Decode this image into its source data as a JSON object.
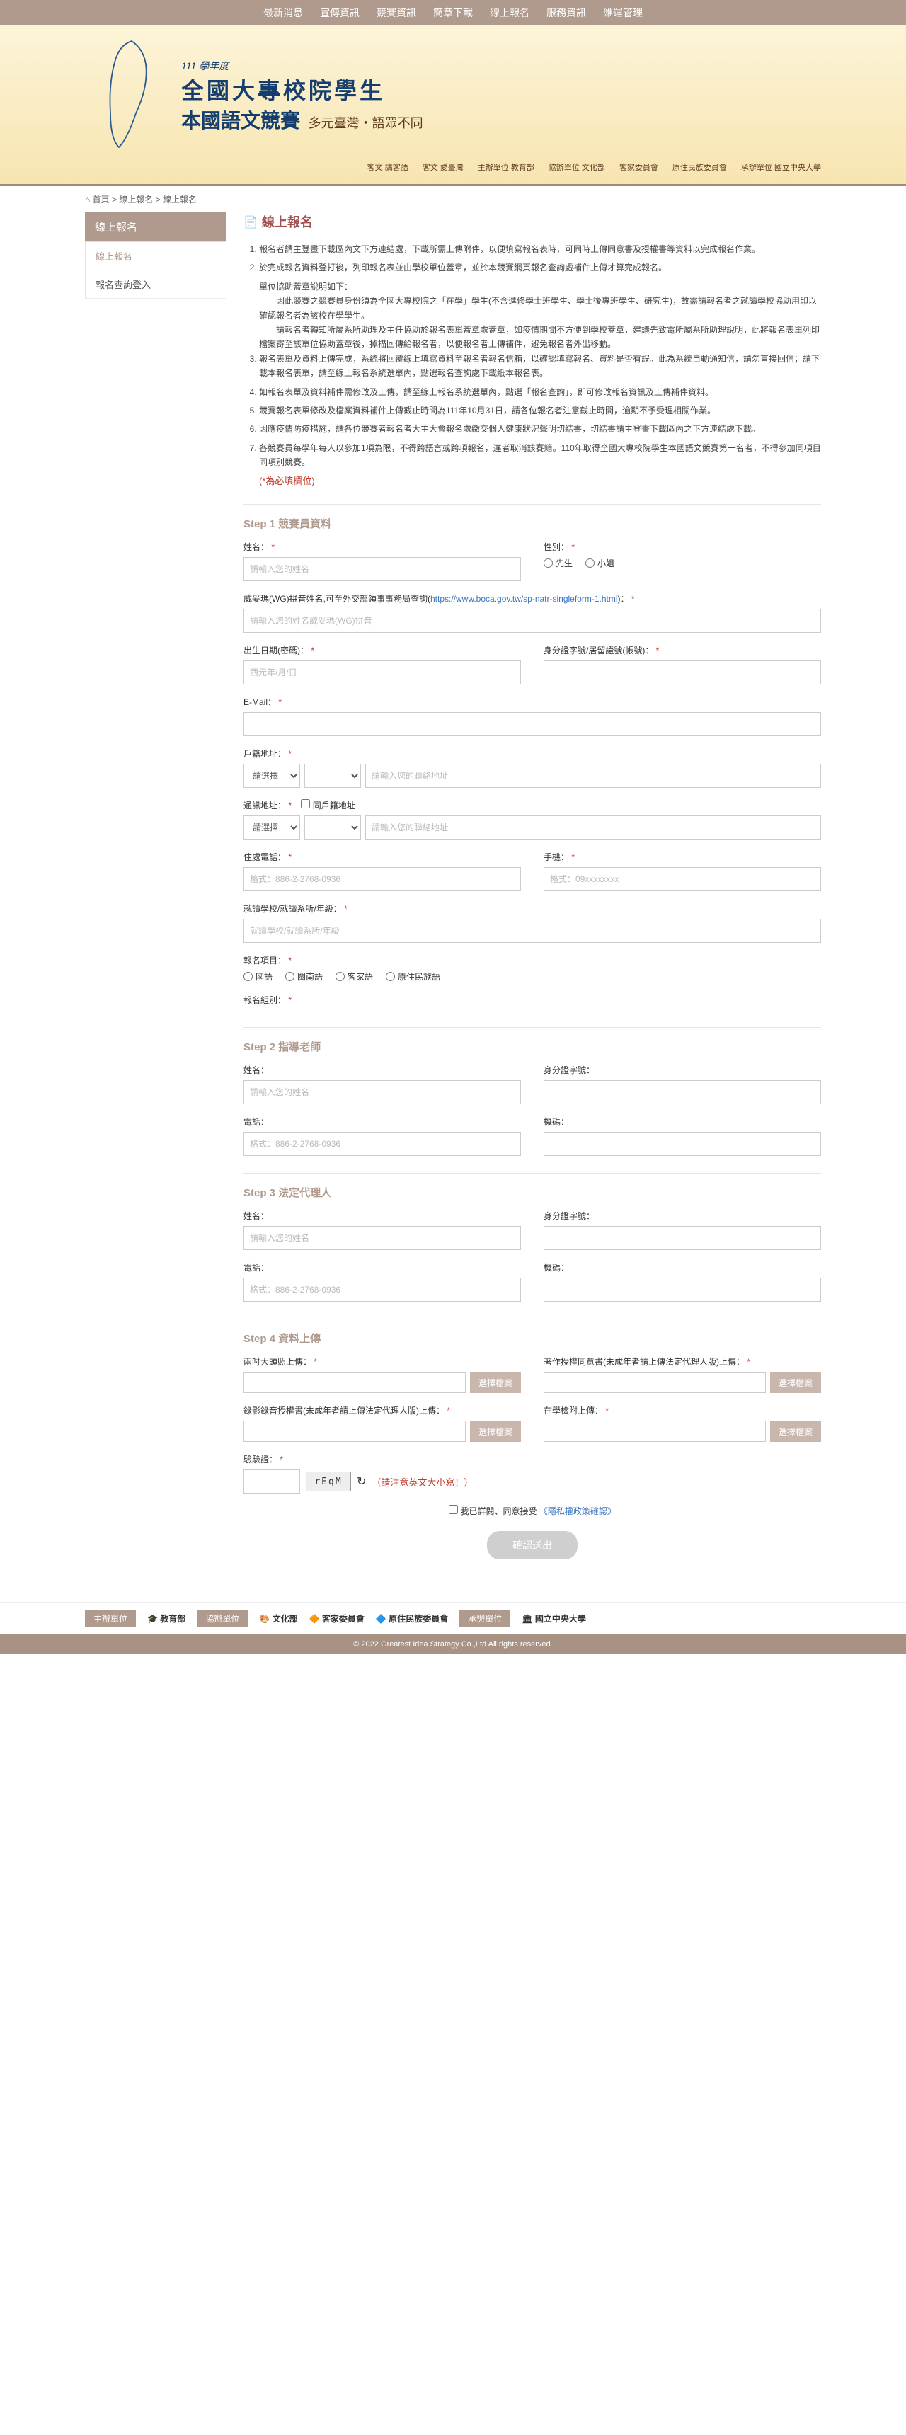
{
  "nav": [
    "最新消息",
    "宣傳資訊",
    "競賽資訊",
    "簡章下載",
    "線上報名",
    "服務資訊",
    "維運管理"
  ],
  "banner": {
    "year": "111 學年度",
    "line1": "全國大專校院學生",
    "line2": "本國語文競賽",
    "calli": "多元臺灣・語眾不同",
    "logos": [
      "客文 講客語",
      "客文 愛臺灣",
      "主辦單位 教育部",
      "協辦單位 文化部",
      "客家委員會",
      "原住民族委員會",
      "承辦單位 國立中央大學"
    ]
  },
  "crumbs": {
    "home": "首頁",
    "p1": "線上報名",
    "p2": "線上報名"
  },
  "sidebar": {
    "title": "線上報名",
    "items": [
      "線上報名",
      "報名查詢登入"
    ]
  },
  "page": {
    "title": "線上報名"
  },
  "instructions": [
    "報名者請主登畫下載區內文下方連結處，下載所需上傳附件，以便填寫報名表時，可同時上傳同意書及授權書等資料以完成報名作業。",
    "於完成報名資料登打後，列印報名表並由學校單位蓋章，並於本競賽網頁報名查詢處補件上傳才算完成報名。",
    "報名表單及資料上傳完成，系統將回覆線上填寫資料至報名者報名信箱，以確認填寫報名、資料是否有誤。此為系統自動通知信，請勿直接回信；請下載本報名表單，請至線上報名系統選單內，點選報名查詢處下載紙本報名表。",
    "如報名表單及資料補件需修改及上傳，請至線上報名系統選單內，點選「報名查詢」，即可修改報名資訊及上傳補件資料。",
    "競賽報名表單修改及檔案資料補件上傳截止時間為111年10月31日，請各位報名者注意截止時間，逾期不予受理相關作業。",
    "因應疫情防疫措施，請各位競賽者報名者大主大會報名處繳交個人健康狀況聲明切結書，切結書請主登畫下載區內之下方連結處下載。",
    "各競賽員每學年每人以參加1項為限，不得跨語言或跨項報名，違者取消該賽籍。110年取得全國大專校院學生本國語文競賽第一名者，不得參加同項目同項別競賽。"
  ],
  "ins_sub": {
    "a": "單位協助蓋章說明如下：",
    "b": "因此競賽之競賽員身份須為全國大專校院之「在學」學生(不含進修學士班學生、學士後專班學生、研究生)，故需請報名者之就讀學校協助用印以確認報名者為該校在學學生。",
    "c": "請報名者轉知所屬系所助理及主任協助於報名表單蓋章處蓋章，如疫情期間不方便到學校蓋章，建議先致電所屬系所助理說明，此將報名表單列印檔案寄至該單位協助蓋章後，掉描回傳給報名者，以便報名者上傳補件，避免報名者外出移動。"
  },
  "required_note": "(*為必填欄位)",
  "step1": {
    "title": "Step 1 競賽員資料",
    "name": {
      "label": "姓名：",
      "ph": "請輸入您的姓名"
    },
    "gender": {
      "label": "性別：",
      "opt1": "先生",
      "opt2": "小姐"
    },
    "wg": {
      "label_pre": "威妥瑪(WG)拼音姓名,可至外交部領事事務局查詢(",
      "url_text": "https://www.boca.gov.tw/sp-natr-singleform-1.html",
      "label_post": ")：",
      "ph": "請輸入您的姓名威妥瑪(WG)拼音"
    },
    "birth": {
      "label": "出生日期(密碼)：",
      "ph": "西元年/月/日"
    },
    "id": {
      "label": "身分證字號/居留證號(帳號)："
    },
    "email": {
      "label": "E-Mail："
    },
    "addr1": {
      "label": "戶籍地址：",
      "sel": "請選擇",
      "ph": "請輸入您的聯絡地址"
    },
    "addr2": {
      "label": "通訊地址：",
      "same": "同戶籍地址",
      "sel": "請選擇",
      "ph": "請輸入您的聯絡地址"
    },
    "phone": {
      "label": "住處電話：",
      "ph": "格式：886-2-2768-0936"
    },
    "mobile": {
      "label": "手機：",
      "ph": "格式：09xxxxxxxx"
    },
    "school": {
      "label": "就讀學校/就讀系所/年級：",
      "ph": "就讀學校/就讀系所/年級"
    },
    "item": {
      "label": "報名項目：",
      "opts": [
        "國語",
        "閩南語",
        "客家語",
        "原住民族語"
      ]
    },
    "group": {
      "label": "報名組別："
    }
  },
  "step2": {
    "title": "Step 2 指導老師",
    "name": {
      "label": "姓名：",
      "ph": "請輸入您的姓名"
    },
    "id": {
      "label": "身分證字號："
    },
    "phone": {
      "label": "電話：",
      "ph": "格式：886-2-2768-0936"
    },
    "ext": {
      "label": "機碼："
    }
  },
  "step3": {
    "title": "Step 3 法定代理人",
    "name": {
      "label": "姓名：",
      "ph": "請輸入您的姓名"
    },
    "id": {
      "label": "身分證字號："
    },
    "phone": {
      "label": "電話：",
      "ph": "格式：886-2-2768-0936"
    },
    "ext": {
      "label": "機碼："
    }
  },
  "step4": {
    "title": "Step 4 資料上傳",
    "photo": "兩吋大頭照上傳：",
    "auth": "著作授權同意書(未成年者請上傳法定代理人版)上傳：",
    "rec": "錄影錄音授權書(未成年者請上傳法定代理人版)上傳：",
    "cert": "在學檢附上傳：",
    "browse": "選擇檔案",
    "captcha": {
      "label": "驗驗證：",
      "img": "rEqM",
      "hint": "（請注意英文大小寫！）"
    },
    "consent_pre": "我已詳閱、同意接受",
    "consent_link": "《隱私權政策確認》",
    "submit": "確認送出"
  },
  "footer": {
    "tag1": "主辦單位",
    "org1": "教育部",
    "tag2": "協辦單位",
    "org2": "文化部",
    "org3": "客家委員會",
    "org4": "原住民族委員會",
    "tag3": "承辦單位",
    "org5": "國立中央大學",
    "copy": "© 2022 Greatest Idea Strategy Co.,Ltd All rights reserved."
  }
}
